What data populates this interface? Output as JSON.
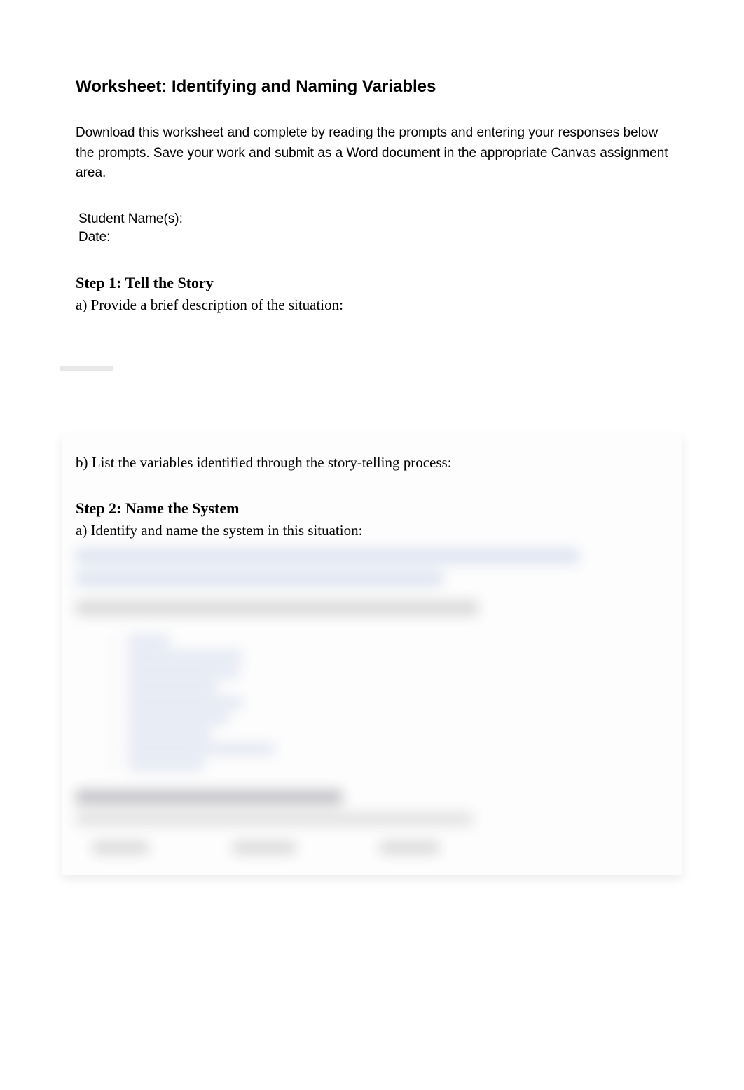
{
  "title": "Worksheet:  Identifying and Naming Variables",
  "instructions": "Download this worksheet and complete by reading the prompts and entering your responses below the prompts.  Save your work and submit as a Word document in the appropriate Canvas assignment area.",
  "fields": {
    "student_name_label": "Student Name(s):",
    "date_label": "Date:"
  },
  "steps": {
    "step1": {
      "heading": "Step 1:  Tell the Story",
      "prompt_a": "a) Provide a brief description of the situation:",
      "prompt_b": "b) List the variables identified through the story-telling process:"
    },
    "step2": {
      "heading": "Step 2:  Name the System",
      "prompt_a": "a) Identify and name the system in this situation:"
    }
  }
}
